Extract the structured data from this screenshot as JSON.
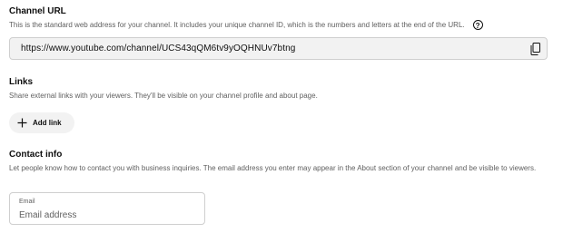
{
  "channel_url": {
    "title": "Channel URL",
    "description": "This is the standard web address for your channel. It includes your unique channel ID, which is the numbers and letters at the end of the URL.",
    "help_icon": "?",
    "url": "https://www.youtube.com/channel/UCS43qQM6tv9yOQHNUv7btng",
    "copy_icon": "copy-icon"
  },
  "links": {
    "title": "Links",
    "description": "Share external links with your viewers. They'll be visible on your channel profile and about page.",
    "add_link_label": "Add link",
    "add_icon": "plus-icon"
  },
  "contact_info": {
    "title": "Contact info",
    "description": "Let people know how to contact you with business inquiries. The email address you enter may appear in the About section of your channel and be visible to viewers.",
    "email_label": "Email",
    "email_placeholder": "Email address",
    "email_value": ""
  }
}
